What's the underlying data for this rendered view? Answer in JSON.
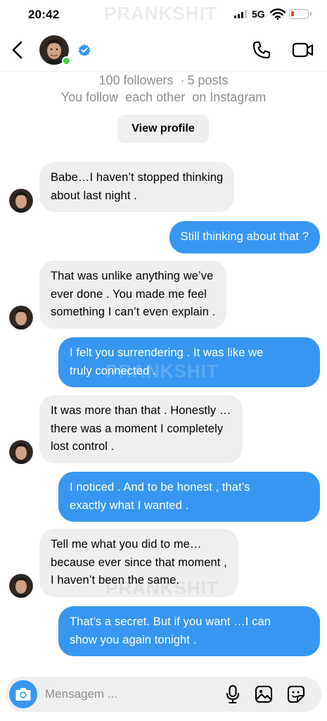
{
  "status_bar": {
    "time": "20:42",
    "network": "5G",
    "watermark": "PRANKSHIT"
  },
  "header": {
    "back_icon": "chevron-left-icon",
    "verified_icon": "verified-badge-icon",
    "call_icon": "phone-icon",
    "video_icon": "video-camera-icon",
    "online": true,
    "colors": {
      "verified": "#3897f0",
      "online": "#3dd54d"
    }
  },
  "profile": {
    "followers": "100 followers",
    "posts": "5 posts",
    "mutual": "You follow  each other  on Instagram",
    "view_profile_label": "View profile"
  },
  "messages": [
    {
      "sender": "them",
      "lines": [
        "Babe…I haven’t stopped  thinking",
        "about  last night ."
      ]
    },
    {
      "sender": "me",
      "lines": [
        "Still thinking  about  that ?"
      ]
    },
    {
      "sender": "them",
      "lines": [
        "That was unlike  anything  we’ve",
        "ever done . You made me feel",
        "something  I can’t even explain ."
      ]
    },
    {
      "sender": "me",
      "lines": [
        "I felt you surrendering  . It was like we",
        "truly  connected ."
      ]
    },
    {
      "sender": "them",
      "lines": [
        "It was more  than  that . Honestly …",
        "there  was a moment  I completely",
        "lost control ."
      ]
    },
    {
      "sender": "me",
      "lines": [
        "I noticed . And to be honest , that’s",
        "exactly  what  I wanted ."
      ]
    },
    {
      "sender": "them",
      "lines": [
        "Tell me what  you did to me…",
        "because ever since that  moment ,",
        "I haven’t been the same."
      ]
    },
    {
      "sender": "me",
      "lines": [
        "That’s a secret. But if you want …I can",
        "show  you again tonight ."
      ]
    }
  ],
  "watermarks": [
    "PRANKSHIT",
    "PRANKSHIT"
  ],
  "composer": {
    "placeholder": "Mensagem ...",
    "camera_icon": "camera-icon",
    "mic_icon": "microphone-icon",
    "gallery_icon": "image-gallery-icon",
    "sticker_icon": "sticker-icon"
  },
  "colors": {
    "outgoing_bubble": "#3797f0",
    "incoming_bubble": "#efefef",
    "secondary_text": "#8e8e8e"
  }
}
